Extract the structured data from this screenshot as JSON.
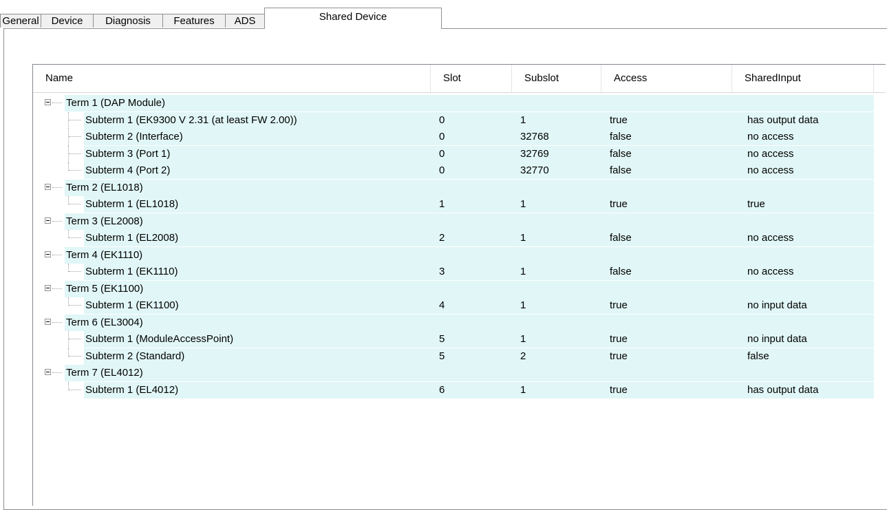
{
  "tabs": [
    {
      "label": "General",
      "active": false
    },
    {
      "label": "Device",
      "active": false
    },
    {
      "label": "Diagnosis",
      "active": false
    },
    {
      "label": "Features",
      "active": false
    },
    {
      "label": "ADS",
      "active": false
    },
    {
      "label": "Shared Device",
      "active": true
    }
  ],
  "grid": {
    "columns": [
      "Name",
      "Slot",
      "Subslot",
      "Access",
      "SharedInput"
    ],
    "rows": [
      {
        "level": 0,
        "name": "Term 1 (DAP Module)",
        "slot": "",
        "subslot": "",
        "access": "",
        "shared": ""
      },
      {
        "level": 1,
        "name": "Subterm 1 (EK9300 V 2.31 (at least FW 2.00))",
        "slot": "0",
        "subslot": "1",
        "access": "true",
        "shared": "has output data"
      },
      {
        "level": 1,
        "name": "Subterm 2 (Interface)",
        "slot": "0",
        "subslot": "32768",
        "access": "false",
        "shared": "no access"
      },
      {
        "level": 1,
        "name": "Subterm 3 (Port 1)",
        "slot": "0",
        "subslot": "32769",
        "access": "false",
        "shared": "no access"
      },
      {
        "level": 1,
        "name": "Subterm 4 (Port 2)",
        "slot": "0",
        "subslot": "32770",
        "access": "false",
        "shared": "no access"
      },
      {
        "level": 0,
        "name": "Term 2 (EL1018)",
        "slot": "",
        "subslot": "",
        "access": "",
        "shared": ""
      },
      {
        "level": 1,
        "name": "Subterm 1 (EL1018)",
        "slot": "1",
        "subslot": "1",
        "access": "true",
        "shared": "true"
      },
      {
        "level": 0,
        "name": "Term 3 (EL2008)",
        "slot": "",
        "subslot": "",
        "access": "",
        "shared": ""
      },
      {
        "level": 1,
        "name": "Subterm 1 (EL2008)",
        "slot": "2",
        "subslot": "1",
        "access": "false",
        "shared": "no access"
      },
      {
        "level": 0,
        "name": "Term 4 (EK1110)",
        "slot": "",
        "subslot": "",
        "access": "",
        "shared": ""
      },
      {
        "level": 1,
        "name": "Subterm 1 (EK1110)",
        "slot": "3",
        "subslot": "1",
        "access": "false",
        "shared": "no access"
      },
      {
        "level": 0,
        "name": "Term 5 (EK1100)",
        "slot": "",
        "subslot": "",
        "access": "",
        "shared": ""
      },
      {
        "level": 1,
        "name": "Subterm 1 (EK1100)",
        "slot": "4",
        "subslot": "1",
        "access": "true",
        "shared": "no input data"
      },
      {
        "level": 0,
        "name": "Term 6 (EL3004)",
        "slot": "",
        "subslot": "",
        "access": "",
        "shared": ""
      },
      {
        "level": 1,
        "name": "Subterm 1 (ModuleAccessPoint)",
        "slot": "5",
        "subslot": "1",
        "access": "true",
        "shared": "no input data"
      },
      {
        "level": 1,
        "name": "Subterm 2 (Standard)",
        "slot": "5",
        "subslot": "2",
        "access": "true",
        "shared": "false"
      },
      {
        "level": 0,
        "name": "Term 7 (EL4012)",
        "slot": "",
        "subslot": "",
        "access": "",
        "shared": ""
      },
      {
        "level": 1,
        "name": "Subterm 1 (EL4012)",
        "slot": "6",
        "subslot": "1",
        "access": "true",
        "shared": "has output data"
      }
    ]
  },
  "colors": {
    "row_highlight": "#e1f6f6",
    "border": "#8e8f8f"
  }
}
